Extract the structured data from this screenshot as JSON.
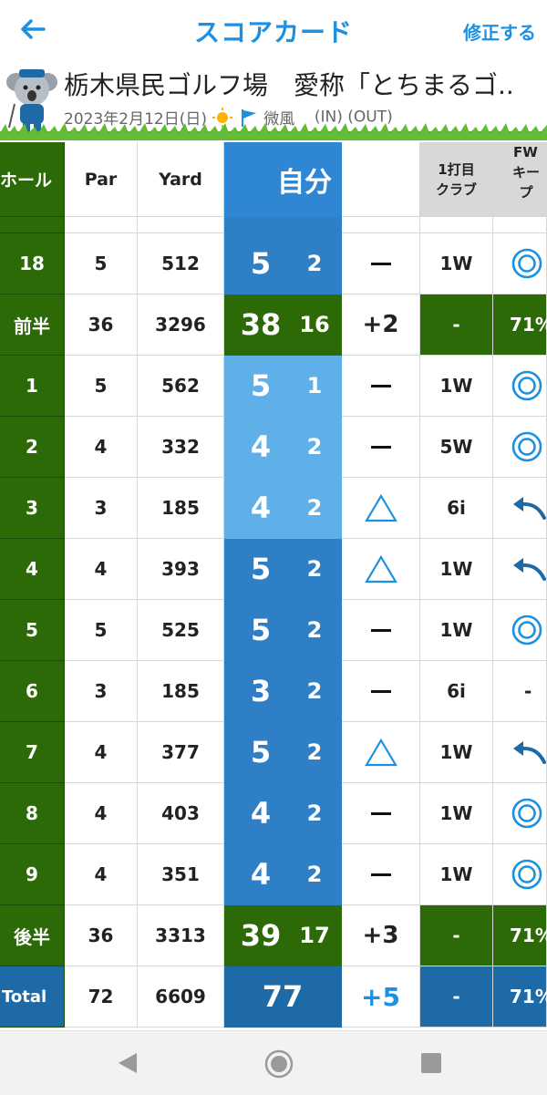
{
  "header": {
    "title": "スコアカード",
    "edit_label": "修正する"
  },
  "course": {
    "name": "栃木県民ゴルフ場　愛称「とちまるゴ..",
    "date": "2023年2月12日(日)",
    "weather_icon": "sun-icon",
    "wind_icon": "flag-icon",
    "wind": "微風",
    "nines": "(IN) (OUT)"
  },
  "columns": {
    "hole": "ホール",
    "par": "Par",
    "yard": "Yard",
    "player": "自分",
    "club_line1": "1打目",
    "club_line2": "クラブ",
    "fw_line1": "FW",
    "fw_line2": "キープ"
  },
  "colors": {
    "accent": "#1e90e0",
    "hole_green": "#2c6a08",
    "total_blue": "#1e6aa6",
    "score_par": "#2f7fc6",
    "score_bogey": "#5fb0e8",
    "header_grey": "#d8d8d8"
  },
  "rows": [
    {
      "type": "hole",
      "hole": "18",
      "par": "5",
      "yard": "512",
      "strokes": "5",
      "putts": "2",
      "result": "dash",
      "club": "1W",
      "fw": "circle",
      "shade": "par"
    },
    {
      "type": "sum",
      "hole": "前半",
      "par": "36",
      "yard": "3296",
      "strokes": "38",
      "putts": "16",
      "result": "+2",
      "club": "-",
      "fw": "71%"
    },
    {
      "type": "hole",
      "hole": "1",
      "par": "5",
      "yard": "562",
      "strokes": "5",
      "putts": "1",
      "result": "dash",
      "club": "1W",
      "fw": "circle",
      "shade": "light"
    },
    {
      "type": "hole",
      "hole": "2",
      "par": "4",
      "yard": "332",
      "strokes": "4",
      "putts": "2",
      "result": "dash",
      "club": "5W",
      "fw": "circle",
      "shade": "light"
    },
    {
      "type": "hole",
      "hole": "3",
      "par": "3",
      "yard": "185",
      "strokes": "4",
      "putts": "2",
      "result": "triangle",
      "club": "6i",
      "fw": "left-arrow",
      "shade": "light"
    },
    {
      "type": "hole",
      "hole": "4",
      "par": "4",
      "yard": "393",
      "strokes": "5",
      "putts": "2",
      "result": "triangle",
      "club": "1W",
      "fw": "left-arrow",
      "shade": "par"
    },
    {
      "type": "hole",
      "hole": "5",
      "par": "5",
      "yard": "525",
      "strokes": "5",
      "putts": "2",
      "result": "dash",
      "club": "1W",
      "fw": "circle",
      "shade": "par"
    },
    {
      "type": "hole",
      "hole": "6",
      "par": "3",
      "yard": "185",
      "strokes": "3",
      "putts": "2",
      "result": "dash",
      "club": "6i",
      "fw": "-",
      "shade": "par"
    },
    {
      "type": "hole",
      "hole": "7",
      "par": "4",
      "yard": "377",
      "strokes": "5",
      "putts": "2",
      "result": "triangle",
      "club": "1W",
      "fw": "left-arrow",
      "shade": "par"
    },
    {
      "type": "hole",
      "hole": "8",
      "par": "4",
      "yard": "403",
      "strokes": "4",
      "putts": "2",
      "result": "dash",
      "club": "1W",
      "fw": "circle",
      "shade": "par"
    },
    {
      "type": "hole",
      "hole": "9",
      "par": "4",
      "yard": "351",
      "strokes": "4",
      "putts": "2",
      "result": "dash",
      "club": "1W",
      "fw": "circle",
      "shade": "par"
    },
    {
      "type": "sum",
      "hole": "後半",
      "par": "36",
      "yard": "3313",
      "strokes": "39",
      "putts": "17",
      "result": "+3",
      "club": "-",
      "fw": "71%"
    },
    {
      "type": "total",
      "hole": "Total",
      "par": "72",
      "yard": "6609",
      "strokes": "77",
      "putts": "",
      "result": "+5",
      "club": "-",
      "fw": "71%"
    }
  ],
  "navbar": {
    "back_icon": "nav-back-icon",
    "home_icon": "nav-home-icon",
    "recent_icon": "nav-recent-icon"
  }
}
